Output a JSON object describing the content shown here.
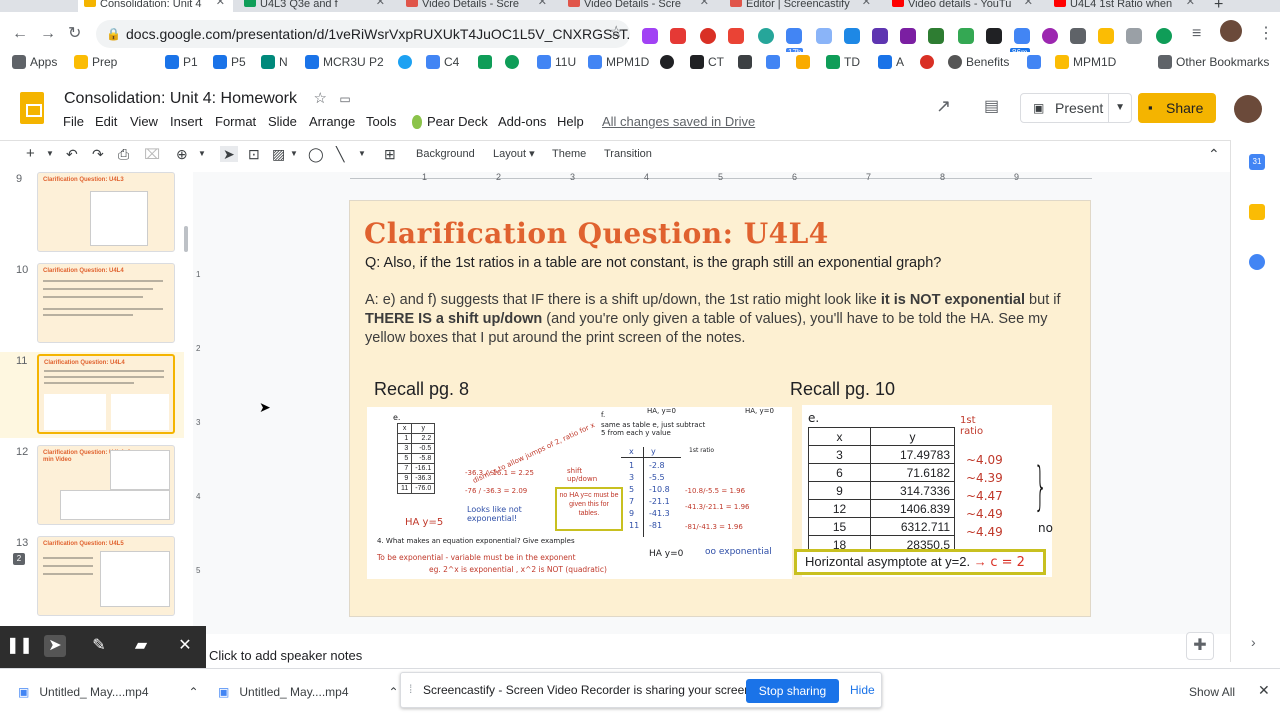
{
  "browser": {
    "tabs": [
      {
        "title": "Consolidation: Unit 4",
        "icon": "slides-icon",
        "color": "#f4b400"
      },
      {
        "title": "U4L3 Q3e and f",
        "icon": "sheets-icon",
        "color": "#0f9d58"
      },
      {
        "title": "Video Details - Scre",
        "icon": "screencastify-icon",
        "color": "#e0554a"
      },
      {
        "title": "Video Details - Scre",
        "icon": "screencastify-icon",
        "color": "#e0554a"
      },
      {
        "title": "Editor | Screencastify",
        "icon": "screencastify-icon",
        "color": "#e0554a"
      },
      {
        "title": "Video details - YouTu",
        "icon": "youtube-icon",
        "color": "#ff0000"
      },
      {
        "title": "U4L4 1st Ratio when",
        "icon": "youtube-icon",
        "color": "#ff0000"
      }
    ],
    "new_tab": "+",
    "url": "docs.google.com/presentation/d/1veRiWsrVxpRUXUkT4JuOC1L5V_CNXRGSsT...",
    "bookmarks": [
      {
        "label": "Apps",
        "color": "#5f6368"
      },
      {
        "label": "Prep",
        "color": "#fbbc04"
      },
      {
        "label": "P1",
        "color": "#1a73e8"
      },
      {
        "label": "P5",
        "color": "#1a73e8"
      },
      {
        "label": "N",
        "color": "#00897b"
      },
      {
        "label": "MCR3U P2",
        "color": "#1a73e8"
      },
      {
        "label": "C4",
        "color": "#4285f4"
      },
      {
        "label": "11U",
        "color": "#4285f4"
      },
      {
        "label": "MPM1D",
        "color": "#4285f4"
      },
      {
        "label": "CT",
        "color": "#202124"
      },
      {
        "label": "TD",
        "color": "#0f9d58"
      },
      {
        "label": "A",
        "color": "#1a73e8"
      },
      {
        "label": "Benefits",
        "color": "#555555"
      },
      {
        "label": "MPM1D",
        "color": "#fbbc04"
      },
      {
        "label": "Other Bookmarks",
        "color": "#5f6368"
      }
    ],
    "ext_badges": {
      "calendar": "17h",
      "timer": "86m"
    }
  },
  "docs": {
    "title": "Consolidation: Unit 4: Homework",
    "menus": [
      "File",
      "Edit",
      "View",
      "Insert",
      "Format",
      "Slide",
      "Arrange",
      "Tools",
      "Pear Deck",
      "Add-ons",
      "Help"
    ],
    "save_status": "All changes saved in Drive",
    "present_label": "Present",
    "share_label": "Share",
    "toolbar": [
      "Background",
      "Layout",
      "Theme",
      "Transition"
    ]
  },
  "filmstrip": [
    {
      "num": "9",
      "title": "Clarification Question: U4L3"
    },
    {
      "num": "10",
      "title": "Clarification Question: U4L4"
    },
    {
      "num": "11",
      "title": "Clarification Question: U4L4",
      "selected": true
    },
    {
      "num": "12",
      "title": "Clarification Question: U4L4: 3 min Video"
    },
    {
      "num": "13",
      "title": "Clarification Question: U4L5"
    }
  ],
  "ruler": [
    "1",
    "2",
    "3",
    "4",
    "5",
    "6",
    "7",
    "8",
    "9"
  ],
  "vruler": [
    "1",
    "2",
    "3",
    "4",
    "5"
  ],
  "slide": {
    "title": "Clarification Question: U4L4",
    "question": "Q: Also, if the 1st ratios in a table are not constant, is the graph still an exponential graph?",
    "answer_parts": [
      "A: e) and f) suggests that IF there is a shift up/down, the 1st ratio might look like ",
      "it is NOT exponential",
      " but if ",
      "THERE IS a shift up/down",
      " (and you're only given a table of values), you'll have to be told the HA. See my yellow boxes that I put around the print screen of the notes."
    ],
    "recall_left": "Recall pg. 8",
    "recall_right": "Recall pg. 10",
    "notes_left": {
      "label_e": "e.",
      "table_x": [
        "x",
        "1",
        "3",
        "5",
        "7",
        "9",
        "11"
      ],
      "table_y": [
        "y",
        "2.2",
        "-0.5",
        "-5.8",
        "-16.1",
        "-36.3",
        "-76.0"
      ],
      "annot_dismiss": "dismiss to allow jumps of 2, ratio for x",
      "annot_ratio1": "-36.3 / -16.1 = 2.25",
      "annot_ratio2": "-76 / -36.3 = 2.09",
      "annot_ha": "HA y=5",
      "annot_looks": "Looks like not exponential!",
      "label_f": "f.",
      "f_desc": "same as table e, just subtract 5 from each y value",
      "f_ha": "HA, y=0",
      "f_ha2": "HA, y=0",
      "f_x": [
        "x",
        "1",
        "3",
        "5",
        "7",
        "9",
        "11"
      ],
      "f_y": [
        "y",
        "-2.8",
        "-5.5",
        "-10.8",
        "-21.1",
        "-41.3",
        "-81"
      ],
      "f_ratios": [
        "-10.8/-5.5 = 1.96",
        "-41.3/-21.1 = 1.96",
        "-81/-41.3 = 1.96"
      ],
      "f_1st": "1st ratio",
      "shift_note": "shift up/down",
      "yellow_box": "no HA y=c must be given this for tables.",
      "q4": "4.   What makes an equation exponential?  Give examples",
      "q4_answer": "To be exponential - variable must be in the exponent",
      "q4_eg": "eg. 2^x is exponential , x^2 is NOT (quadratic)",
      "ha_bottom": "HA y=0",
      "oo_exp": "oo exponential"
    },
    "notes_right": {
      "label_e": "e.",
      "first_ratio": "1st ratio",
      "table": [
        [
          "x",
          "y"
        ],
        [
          "3",
          "17.49783"
        ],
        [
          "6",
          "71.6182"
        ],
        [
          "9",
          "314.7336"
        ],
        [
          "12",
          "1406.839"
        ],
        [
          "15",
          "6312.711"
        ],
        [
          "18",
          "28350.5"
        ]
      ],
      "ratios": [
        "~4.09",
        "~4.39",
        "~4.47",
        "~4.49",
        "~4.49"
      ],
      "no_text": "no",
      "asymptote": "Horizontal asymptote at y=2.",
      "c_eq": "c = 2"
    }
  },
  "speaker_notes_placeholder": "Click to add speaker notes",
  "downloads": [
    {
      "name": "Untitled_ May....mp4"
    },
    {
      "name": "Untitled_ May....mp4"
    }
  ],
  "share_bar": {
    "message": "Screencastify - Screen Video Recorder is sharing your screen.",
    "stop": "Stop sharing",
    "hide": "Hide"
  },
  "show_all": "Show All",
  "colors": {
    "accent_orange": "#e0622f",
    "share_yellow": "#f4b400",
    "ink_red": "#c0392b",
    "ink_blue": "#2f4fa8",
    "highlight_box": "#c8c020"
  }
}
